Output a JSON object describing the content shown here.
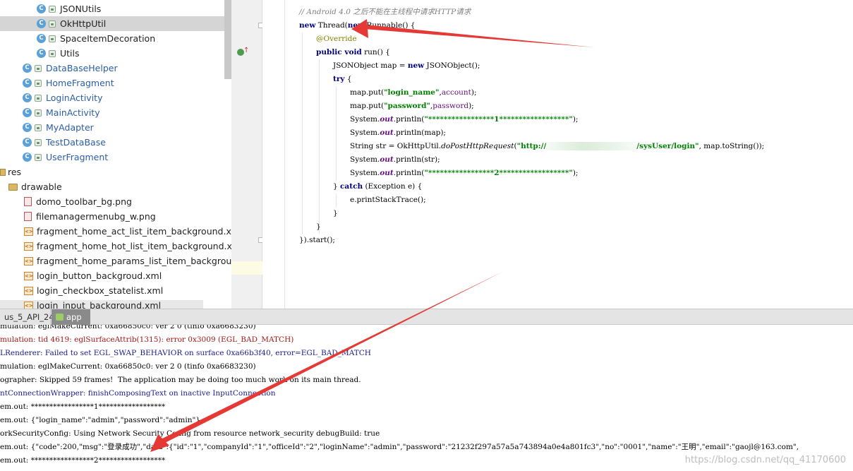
{
  "project_tree": {
    "classes": [
      {
        "label": "JSONUtils",
        "selected": false,
        "color": "dark"
      },
      {
        "label": "OkHttpUtil",
        "selected": true,
        "color": "dark"
      },
      {
        "label": "SpaceItemDecoration",
        "selected": false,
        "color": "dark"
      },
      {
        "label": "Utils",
        "selected": false,
        "color": "dark"
      },
      {
        "label": "DataBaseHelper",
        "selected": false,
        "color": "blue"
      },
      {
        "label": "HomeFragment",
        "selected": false,
        "color": "blue"
      },
      {
        "label": "LoginActivity",
        "selected": false,
        "color": "blue"
      },
      {
        "label": "MainActivity",
        "selected": false,
        "color": "blue"
      },
      {
        "label": "MyAdapter",
        "selected": false,
        "color": "blue"
      },
      {
        "label": "TestDataBase",
        "selected": false,
        "color": "blue"
      },
      {
        "label": "UserFragment",
        "selected": false,
        "color": "blue"
      }
    ],
    "res_label": "res",
    "drawable_label": "drawable",
    "drawable_files": [
      {
        "label": "domo_toolbar_bg.png",
        "kind": "image"
      },
      {
        "label": "filemanagermenubg_w.png",
        "kind": "image"
      },
      {
        "label": "fragment_home_act_list_item_background.xml",
        "kind": "xml"
      },
      {
        "label": "fragment_home_hot_list_item_background.xml",
        "kind": "xml"
      },
      {
        "label": "fragment_home_params_list_item_background.xr",
        "kind": "xml"
      },
      {
        "label": "login_button_backgroud.xml",
        "kind": "xml"
      },
      {
        "label": "login_checkbox_statelist.xml",
        "kind": "xml"
      },
      {
        "label": "login_input_background.xml",
        "kind": "xml"
      }
    ]
  },
  "code": {
    "comment": "// Android 4.0 之后不能在主线程中请求HTTP请求",
    "blurred_url_part": "",
    "lines": {
      "l1_kw": "new",
      "l1_rest": " Thread(",
      "l1_kw2": "new",
      "l1_rest2": " Runnable() {",
      "l2": "@Override",
      "l3_kw": "public void",
      "l3_rest": " run() {",
      "l4_a": "JSONObject map = ",
      "l4_kw": "new",
      "l4_b": " JSONObject();",
      "l5_kw": "try",
      "l5_rest": " {",
      "l6_a": "map.put(",
      "l6_str": "\"login_name\"",
      "l6_b": ",",
      "l6_fld": "account",
      "l6_c": ");",
      "l7_a": "map.put(",
      "l7_str": "\"password\"",
      "l7_b": ",",
      "l7_fld": "password",
      "l7_c": ");",
      "l8_a": "System.",
      "l8_fld": "out",
      "l8_b": ".println(",
      "l8_str": "\"*****************1******************\"",
      "l8_c": ");",
      "l9_a": "System.",
      "l9_fld": "out",
      "l9_b": ".println(map);",
      "l10_a": "String str = OkHttpUtil.",
      "l10_m": "doPostHttpRequest",
      "l10_b": "(",
      "l10_str1": "\"http://",
      "l10_str2": "/sysUser/login\"",
      "l10_c": ", map.toString());",
      "l11_a": "System.",
      "l11_fld": "out",
      "l11_b": ".println(str);",
      "l12_a": "System.",
      "l12_fld": "out",
      "l12_b": ".println(",
      "l12_str": "\"*****************2******************\"",
      "l12_c": ");",
      "l13_a": "} ",
      "l13_kw": "catch",
      "l13_b": " (Exception e) {",
      "l14": "e.printStackTrace();",
      "l15": "}",
      "l16": "}",
      "l17": "}).start();"
    }
  },
  "tabs": {
    "emulator": "us_5_API_24",
    "app": "app"
  },
  "logcat": [
    {
      "text": "mulation: eglMakeCurrent: 0xa66850c0: ver 2 0 (tinfo 0xa6683230)",
      "level": "info"
    },
    {
      "text": "mulation: tid 4619: eglSurfaceAttrib(1315): error 0x3009 (EGL_BAD_MATCH)",
      "level": "error"
    },
    {
      "text": "LRenderer: Failed to set EGL_SWAP_BEHAVIOR on surface 0xa66b3f40, error=EGL_BAD_MATCH",
      "level": "warn"
    },
    {
      "text": "mulation: eglMakeCurrent: 0xa66850c0: ver 2 0 (tinfo 0xa6683230)",
      "level": "info"
    },
    {
      "text": "ographer: Skipped 59 frames!  The application may be doing too much work on its main thread.",
      "level": "info"
    },
    {
      "text": "ntConnectionWrapper: finishComposingText on inactive InputConnection",
      "level": "warn"
    },
    {
      "text": "em.out: *****************1******************",
      "level": "info"
    },
    {
      "text": "em.out: {\"login_name\":\"admin\",\"password\":\"admin\"}",
      "level": "info"
    },
    {
      "text": "orkSecurityConfig: Using Network Security Config from resource network_security debugBuild: true",
      "level": "info"
    },
    {
      "text": "em.out: {\"code\":200,\"msg\":\"登录成功\",\"data\":{\"id\":\"1\",\"companyId\":\"1\",\"officeId\":\"2\",\"loginName\":\"admin\",\"password\":\"21232f297a57a5a743894a0e4a801fc3\",\"no\":\"0001\",\"name\":\"王明\",\"email\":\"gaojl@163.com\",",
      "level": "info"
    },
    {
      "text": "em.out: *****************2******************",
      "level": "info"
    }
  ],
  "watermark": "https://blog.csdn.net/qq_41170600",
  "colors": {
    "keyword": "#000080",
    "string": "#008000",
    "annotation": "#808000",
    "comment": "#808080",
    "field": "#660e7a",
    "arrow": "#e53935",
    "selection": "#d5d5d5",
    "current_line": "#fdfbe4"
  }
}
